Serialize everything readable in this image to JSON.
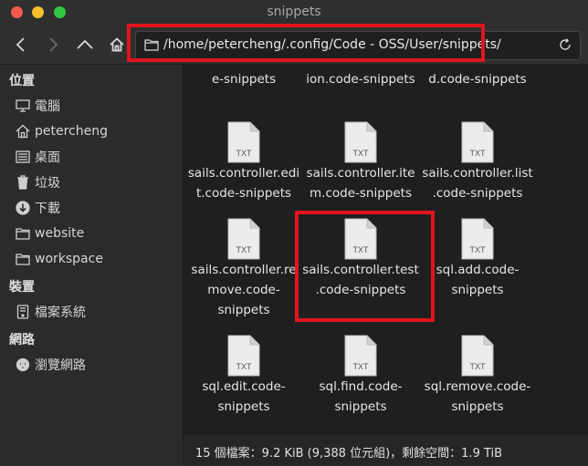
{
  "window": {
    "title": "snippets"
  },
  "toolbar": {
    "path": "/home/petercheng/.config/Code - OSS/User/snippets/"
  },
  "sidebar": {
    "sections": [
      {
        "label": "位置"
      },
      {
        "label": "裝置"
      },
      {
        "label": "網路"
      }
    ],
    "places": [
      {
        "label": "電腦",
        "icon": "computer-icon"
      },
      {
        "label": "petercheng",
        "icon": "home-icon"
      },
      {
        "label": "桌面",
        "icon": "desktop-icon"
      },
      {
        "label": "垃圾",
        "icon": "trash-icon"
      },
      {
        "label": "下載",
        "icon": "download-icon"
      },
      {
        "label": "website",
        "icon": "folder-icon"
      },
      {
        "label": "workspace",
        "icon": "folder-icon"
      }
    ],
    "devices": [
      {
        "label": "檔案系統",
        "icon": "drive-icon"
      }
    ],
    "network": [
      {
        "label": "瀏覽網路",
        "icon": "network-icon"
      }
    ]
  },
  "files": {
    "icon_label": "TXT",
    "partial": [
      {
        "line1": "e-snippets"
      },
      {
        "line1": "ion.code-snippets"
      },
      {
        "line1": "d.code-snippets"
      }
    ],
    "items": [
      {
        "line1": "sails.controller.edi",
        "line2": "t.code-snippets",
        "line3": ""
      },
      {
        "line1": "sails.controller.ite",
        "line2": "m.code-snippets",
        "line3": ""
      },
      {
        "line1": "sails.controller.list",
        "line2": ".code-snippets",
        "line3": ""
      },
      {
        "line1": "sails.controller.re",
        "line2": "move.code-",
        "line3": "snippets"
      },
      {
        "line1": "sails.controller.test",
        "line2": ".code-snippets",
        "line3": ""
      },
      {
        "line1": "sql.add.code-",
        "line2": "snippets",
        "line3": ""
      },
      {
        "line1": "sql.edit.code-",
        "line2": "snippets",
        "line3": ""
      },
      {
        "line1": "sql.find.code-",
        "line2": "snippets",
        "line3": ""
      },
      {
        "line1": "sql.remove.code-",
        "line2": "snippets",
        "line3": ""
      }
    ]
  },
  "status": {
    "text": "15 個檔案：9.2 KiB (9,388 位元組)，剩餘空間：1.9 TiB"
  },
  "colors": {
    "highlight": "#e0151d",
    "background": "#1f1f1f"
  }
}
